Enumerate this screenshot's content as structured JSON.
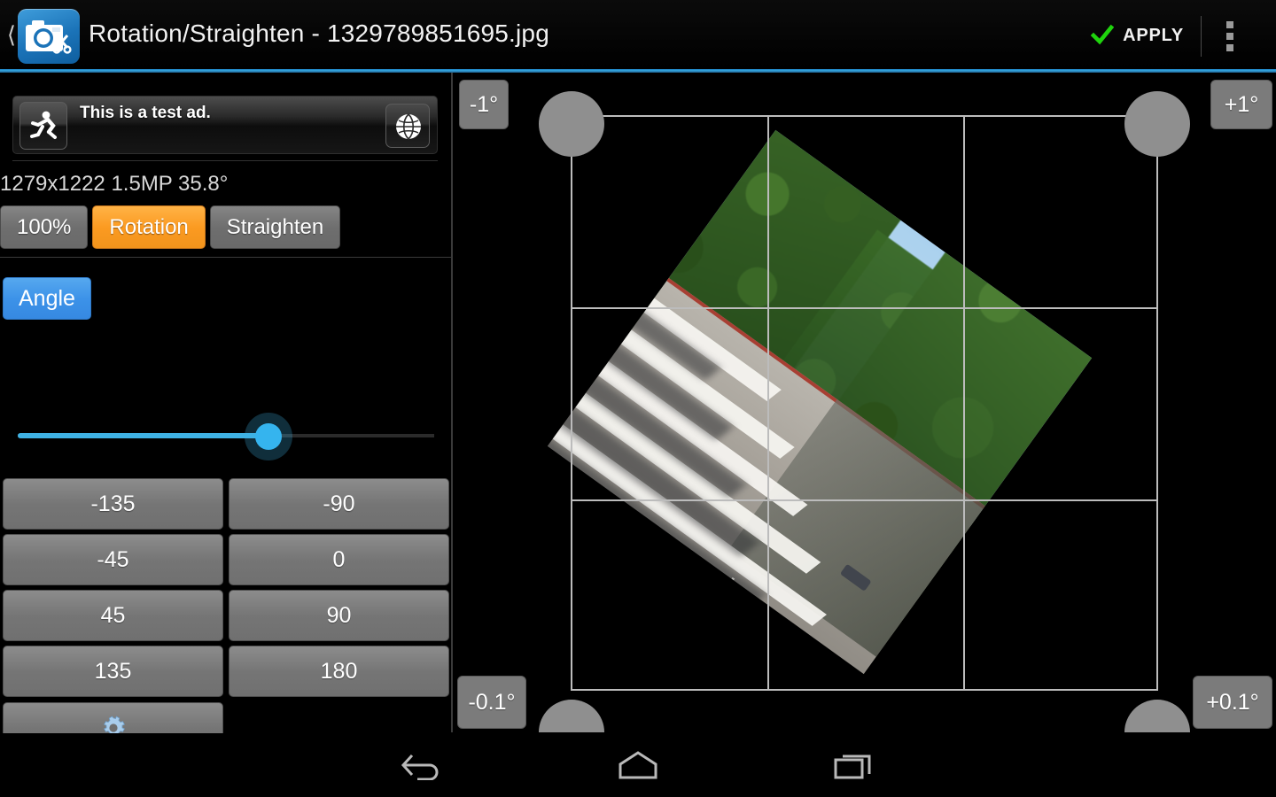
{
  "actionbar": {
    "back_icon": "chevron-left-icon",
    "app_icon": "photo-editor-camera-scissors-icon",
    "title": "Rotation/Straighten - 1329789851695.jpg",
    "apply_label": "APPLY",
    "apply_icon": "green-check-icon",
    "overflow_icon": "overflow-menu-icon",
    "accent_color": "#36a6e0"
  },
  "ad": {
    "text": "This is a test ad.",
    "thumb_icon": "running-person-icon",
    "globe_icon": "globe-icon"
  },
  "image_info": {
    "text": "1279x1222 1.5MP 35.8°",
    "width": "1279",
    "height": "1222",
    "megapixels": "1.5MP",
    "angle": "35.8°"
  },
  "tabs": [
    {
      "label": "100%",
      "selected": false
    },
    {
      "label": "Rotation",
      "selected": true
    },
    {
      "label": "Straighten",
      "selected": false
    }
  ],
  "tool": {
    "mode_label": "Angle",
    "mode_color": "#3c92e8",
    "selected_tab_color": "#fb9a21"
  },
  "slider": {
    "fill_color": "#3fb2e4",
    "thumb_color": "#35b4ee",
    "percent": 60
  },
  "presets": [
    {
      "label": "-135"
    },
    {
      "label": "-90"
    },
    {
      "label": "-45"
    },
    {
      "label": "0"
    },
    {
      "label": "45"
    },
    {
      "label": "90"
    },
    {
      "label": "135"
    },
    {
      "label": "180"
    }
  ],
  "settings": {
    "icon": "gear-icon"
  },
  "nudge": {
    "top_left": "-1°",
    "top_right": "+1°",
    "bottom_left": "-0.1°",
    "bottom_right": "+0.1°"
  },
  "canvas": {
    "rotation_degrees": 35.8,
    "grid": "rule-of-thirds",
    "grid_color": "#bcbcbc",
    "handle_color": "#8f8f8f",
    "handles": [
      "top-left",
      "top-right",
      "bottom-left",
      "bottom-right"
    ]
  },
  "navbar": {
    "back_icon": "android-back-icon",
    "home_icon": "android-home-icon",
    "recents_icon": "android-recents-icon"
  }
}
